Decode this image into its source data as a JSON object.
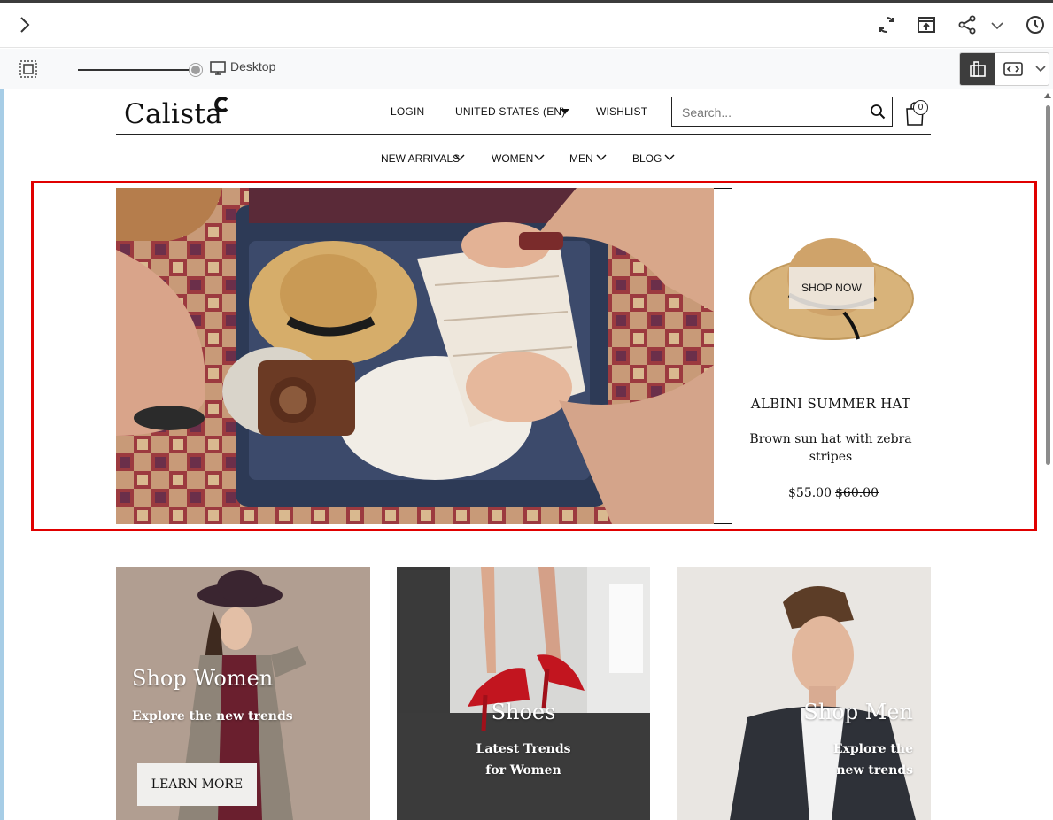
{
  "editor": {
    "device_label": "Desktop"
  },
  "site": {
    "logo": "Calista",
    "top_links": {
      "login": "LOGIN",
      "region": "UNITED STATES (EN)",
      "wishlist": "WISHLIST"
    },
    "search": {
      "placeholder": "Search..."
    },
    "cart": {
      "count": "0"
    },
    "nav": [
      {
        "label": "NEW ARRIVALS"
      },
      {
        "label": "WOMEN"
      },
      {
        "label": "MEN"
      },
      {
        "label": "BLOG"
      }
    ]
  },
  "hero": {
    "shop_now": "SHOP NOW",
    "product": {
      "title": "ALBINI SUMMER HAT",
      "description": "Brown sun hat with zebra stripes",
      "price": "$55.00",
      "old_price": "$60.00"
    }
  },
  "tiles": [
    {
      "title": "Shop Women",
      "subtitle": "Explore the new trends",
      "button": "LEARN MORE"
    },
    {
      "title": "Shoes",
      "subtitle": "Latest Trends for Women"
    },
    {
      "title": "Shop Men",
      "subtitle": "Explore the new trends"
    }
  ],
  "colors": {
    "highlight": "#e00000",
    "editor_dark": "#3d3d3d"
  }
}
